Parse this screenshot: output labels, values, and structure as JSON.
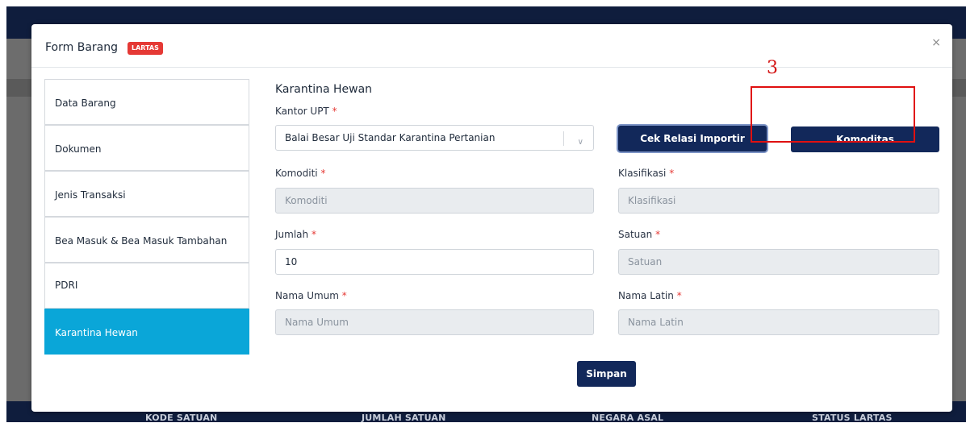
{
  "background": {
    "columns": [
      "KODE SATUAN",
      "JUMLAH SATUAN",
      "NEGARA ASAL",
      "STATUS LARTAS"
    ]
  },
  "modal": {
    "title": "Form Barang",
    "badge": "LARTAS",
    "close": "×"
  },
  "sidebar": {
    "items": [
      {
        "label": "Data Barang"
      },
      {
        "label": "Dokumen"
      },
      {
        "label": "Jenis Transaksi"
      },
      {
        "label": "Bea Masuk & Bea Masuk Tambahan"
      },
      {
        "label": "PDRI"
      },
      {
        "label": "Karantina Hewan"
      }
    ],
    "active_index": 5
  },
  "form": {
    "section_title": "Karantina Hewan",
    "kantor_upt": {
      "label": "Kantor UPT",
      "value": "Balai Besar Uji Standar Karantina Pertanian"
    },
    "cek_relasi_button": "Cek Relasi Importir",
    "komoditas_button": "Komoditas",
    "komoditi": {
      "label": "Komoditi",
      "placeholder": "Komoditi"
    },
    "klasifikasi": {
      "label": "Klasifikasi",
      "placeholder": "Klasifikasi"
    },
    "jumlah": {
      "label": "Jumlah",
      "value": "10"
    },
    "satuan": {
      "label": "Satuan",
      "placeholder": "Satuan"
    },
    "nama_umum": {
      "label": "Nama Umum",
      "placeholder": "Nama Umum"
    },
    "nama_latin": {
      "label": "Nama Latin",
      "placeholder": "Nama Latin"
    },
    "required_mark": "*",
    "save_button": "Simpan"
  },
  "annotation": {
    "number": "3"
  },
  "colors": {
    "primary": "#12285a",
    "active_tab": "#0aa6d8",
    "badge": "#e53935",
    "annotation": "#e01010"
  },
  "icons": {
    "select_chevron": "chevron-down-icon",
    "close": "close-icon"
  }
}
